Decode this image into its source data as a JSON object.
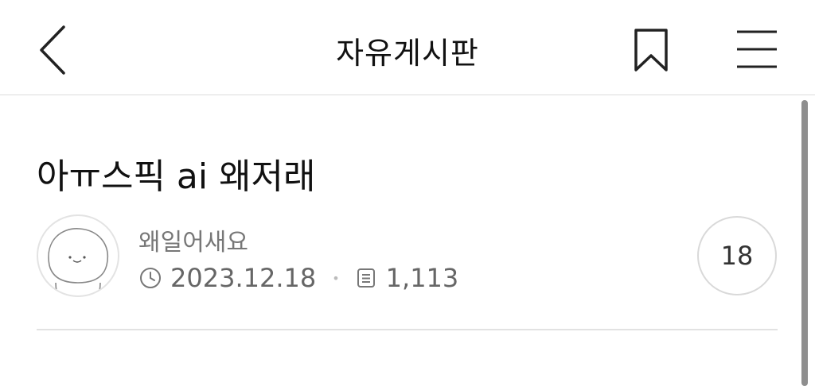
{
  "header": {
    "title": "자유게시판",
    "icons": {
      "back": "chevron-left-icon",
      "bookmark": "bookmark-icon",
      "menu": "hamburger-menu-icon"
    }
  },
  "post": {
    "title": "아ㅠ스픽 ai 왜저래",
    "author": "왜일어새요",
    "date": "2023.12.18",
    "views": "1,113",
    "comment_count": "18"
  },
  "colors": {
    "text": "#111111",
    "meta": "#666666",
    "divider": "#e2e2e2",
    "scrollbar": "#8e8e8e"
  }
}
